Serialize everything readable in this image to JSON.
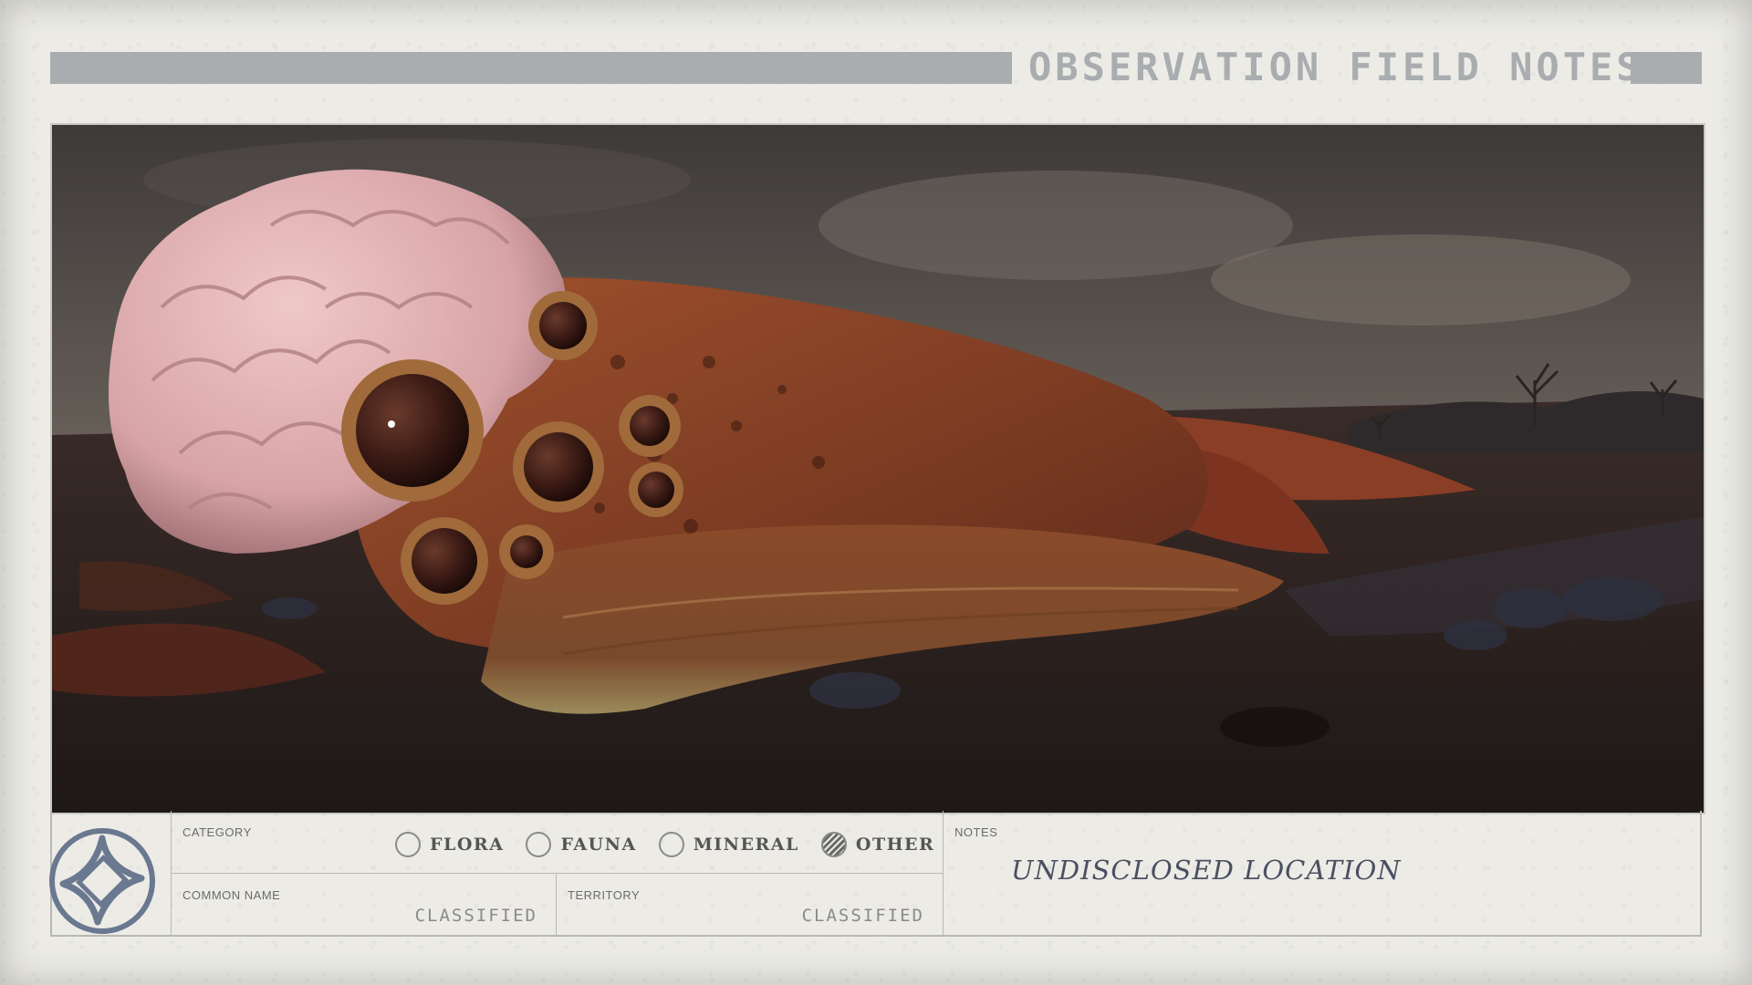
{
  "header": {
    "title": "OBSERVATION FIELD NOTES"
  },
  "photo": {
    "subject_icon": "alien-creature-photo"
  },
  "panel": {
    "logo_icon": "constellation-star-icon",
    "category": {
      "label": "CATEGORY",
      "options": [
        {
          "label": "FLORA",
          "selected": false
        },
        {
          "label": "FAUNA",
          "selected": false
        },
        {
          "label": "MINERAL",
          "selected": false
        },
        {
          "label": "OTHER",
          "selected": true
        }
      ]
    },
    "common_name": {
      "label": "COMMON NAME",
      "value": "CLASSIFIED"
    },
    "territory": {
      "label": "TERRITORY",
      "value": "CLASSIFIED"
    },
    "notes": {
      "label": "NOTES",
      "value": "UNDISCLOSED LOCATION"
    }
  },
  "colors": {
    "paper": "#ecebe6",
    "header_bar": "#a9adb0",
    "ink": "#4a5060"
  }
}
